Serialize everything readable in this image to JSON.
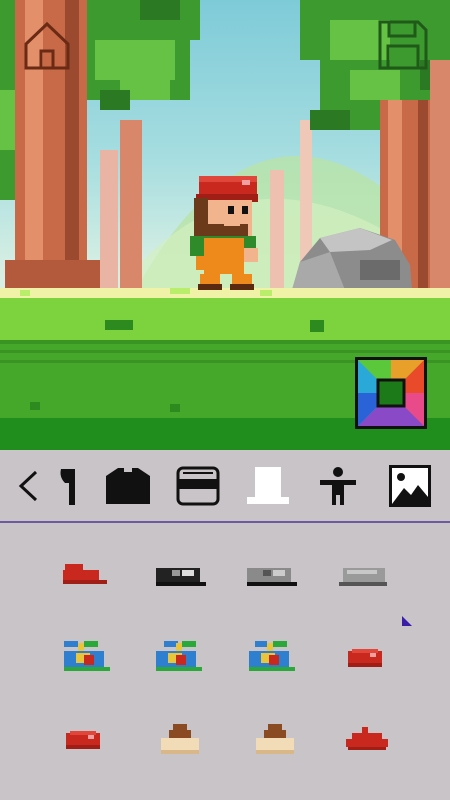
{
  "screen": {
    "buttons": {
      "home": "home-icon",
      "save": "save-icon",
      "color": "color-picker-icon"
    }
  },
  "toolbar": {
    "tabs": [
      {
        "name": "back",
        "icon": "chevron-left-icon"
      },
      {
        "name": "axe",
        "icon": "axe-icon"
      },
      {
        "name": "shirt",
        "icon": "shirt-icon"
      },
      {
        "name": "glasses",
        "icon": "face-glasses-icon"
      },
      {
        "name": "hat",
        "icon": "hat-icon",
        "selected": true
      },
      {
        "name": "body",
        "icon": "body-icon"
      },
      {
        "name": "background",
        "icon": "landscape-icon"
      }
    ],
    "accent": "#6e5aa0"
  },
  "items": [
    {
      "kind": "red-cap",
      "color": "#c8281e"
    },
    {
      "kind": "black-cap",
      "color": "#222222"
    },
    {
      "kind": "grey-black-cap",
      "color": "#8a8a8a"
    },
    {
      "kind": "grey-cap",
      "color": "#9a9a9a"
    },
    {
      "kind": "propeller-cap",
      "color": "#2f7fd0"
    },
    {
      "kind": "propeller-cap",
      "color": "#2f7fd0"
    },
    {
      "kind": "propeller-cap",
      "color": "#2f7fd0"
    },
    {
      "kind": "red-beanie",
      "color": "#c8281e"
    },
    {
      "kind": "red-beanie",
      "color": "#c8281e"
    },
    {
      "kind": "poop-hat",
      "color": "#8a4a22"
    },
    {
      "kind": "poop-hat",
      "color": "#8a4a22"
    },
    {
      "kind": "red-beret",
      "color": "#c8281e"
    }
  ]
}
